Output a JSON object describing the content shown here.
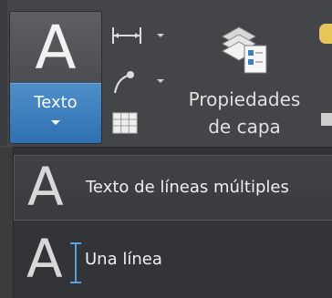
{
  "ribbon": {
    "texto_button": {
      "glyph": "A",
      "label": "Texto"
    },
    "dimension_tool": {
      "icon": "linear-dimension-icon"
    },
    "leader_tool": {
      "icon": "multileader-icon"
    },
    "table_tool": {
      "icon": "table-icon"
    },
    "layer_properties": {
      "icon": "layer-properties-icon",
      "label": "Propiedades\nde capa"
    }
  },
  "dropdown": {
    "items": [
      {
        "glyph": "A",
        "label": "Texto de líneas múltiples",
        "icon": "multiline-text-icon",
        "selected": true
      },
      {
        "glyph": "A",
        "label": "Una línea",
        "icon": "single-line-text-icon",
        "selected": false
      }
    ]
  },
  "colors": {
    "accent_blue": "#3b7fc0",
    "ribbon_bg": "#444549",
    "menu_bg": "#333437"
  }
}
